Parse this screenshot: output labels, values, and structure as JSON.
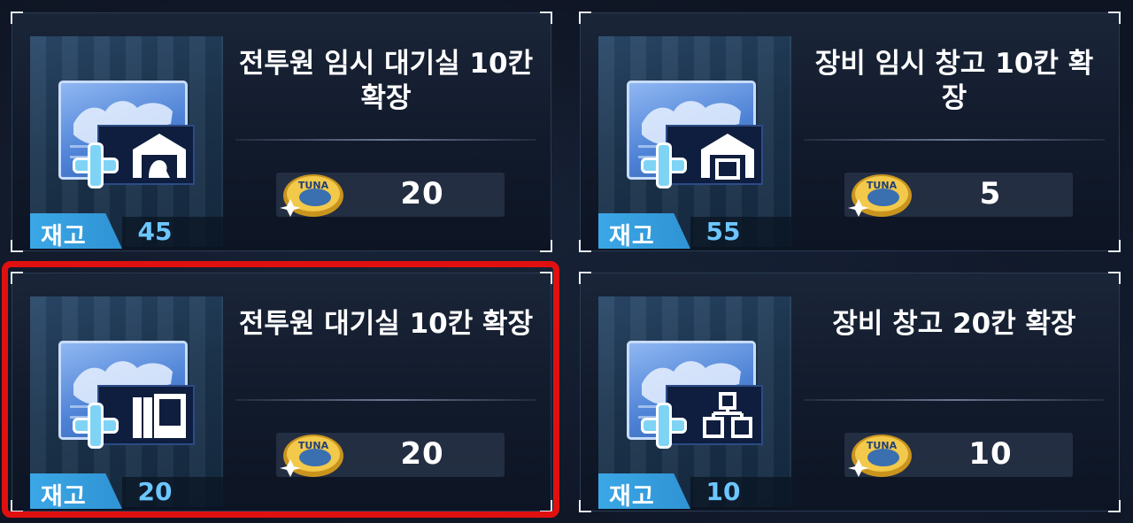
{
  "cards": [
    {
      "title": "전투원 임시 대기실 10칸 확장",
      "price": "20",
      "stock_label": "재고",
      "stock_value": "45",
      "sub_icon": "barracks-icon"
    },
    {
      "title": "장비 임시 창고 10칸 확장",
      "price": "5",
      "stock_label": "재고",
      "stock_value": "55",
      "sub_icon": "warehouse-icon"
    },
    {
      "title": "전투원 대기실 10칸 확장",
      "price": "20",
      "stock_label": "재고",
      "stock_value": "20",
      "sub_icon": "doors-icon"
    },
    {
      "title": "장비 창고 20칸 확장",
      "price": "10",
      "stock_label": "재고",
      "stock_value": "10",
      "sub_icon": "storage-blocks-icon"
    }
  ],
  "currency_icon": "tuna-coin-icon",
  "coin_text": "TUNA",
  "colors": {
    "highlight": "#e01010",
    "stock_tag": "#3ba7e6",
    "stock_value": "#6cc6ff"
  },
  "selected_card_index": 2
}
